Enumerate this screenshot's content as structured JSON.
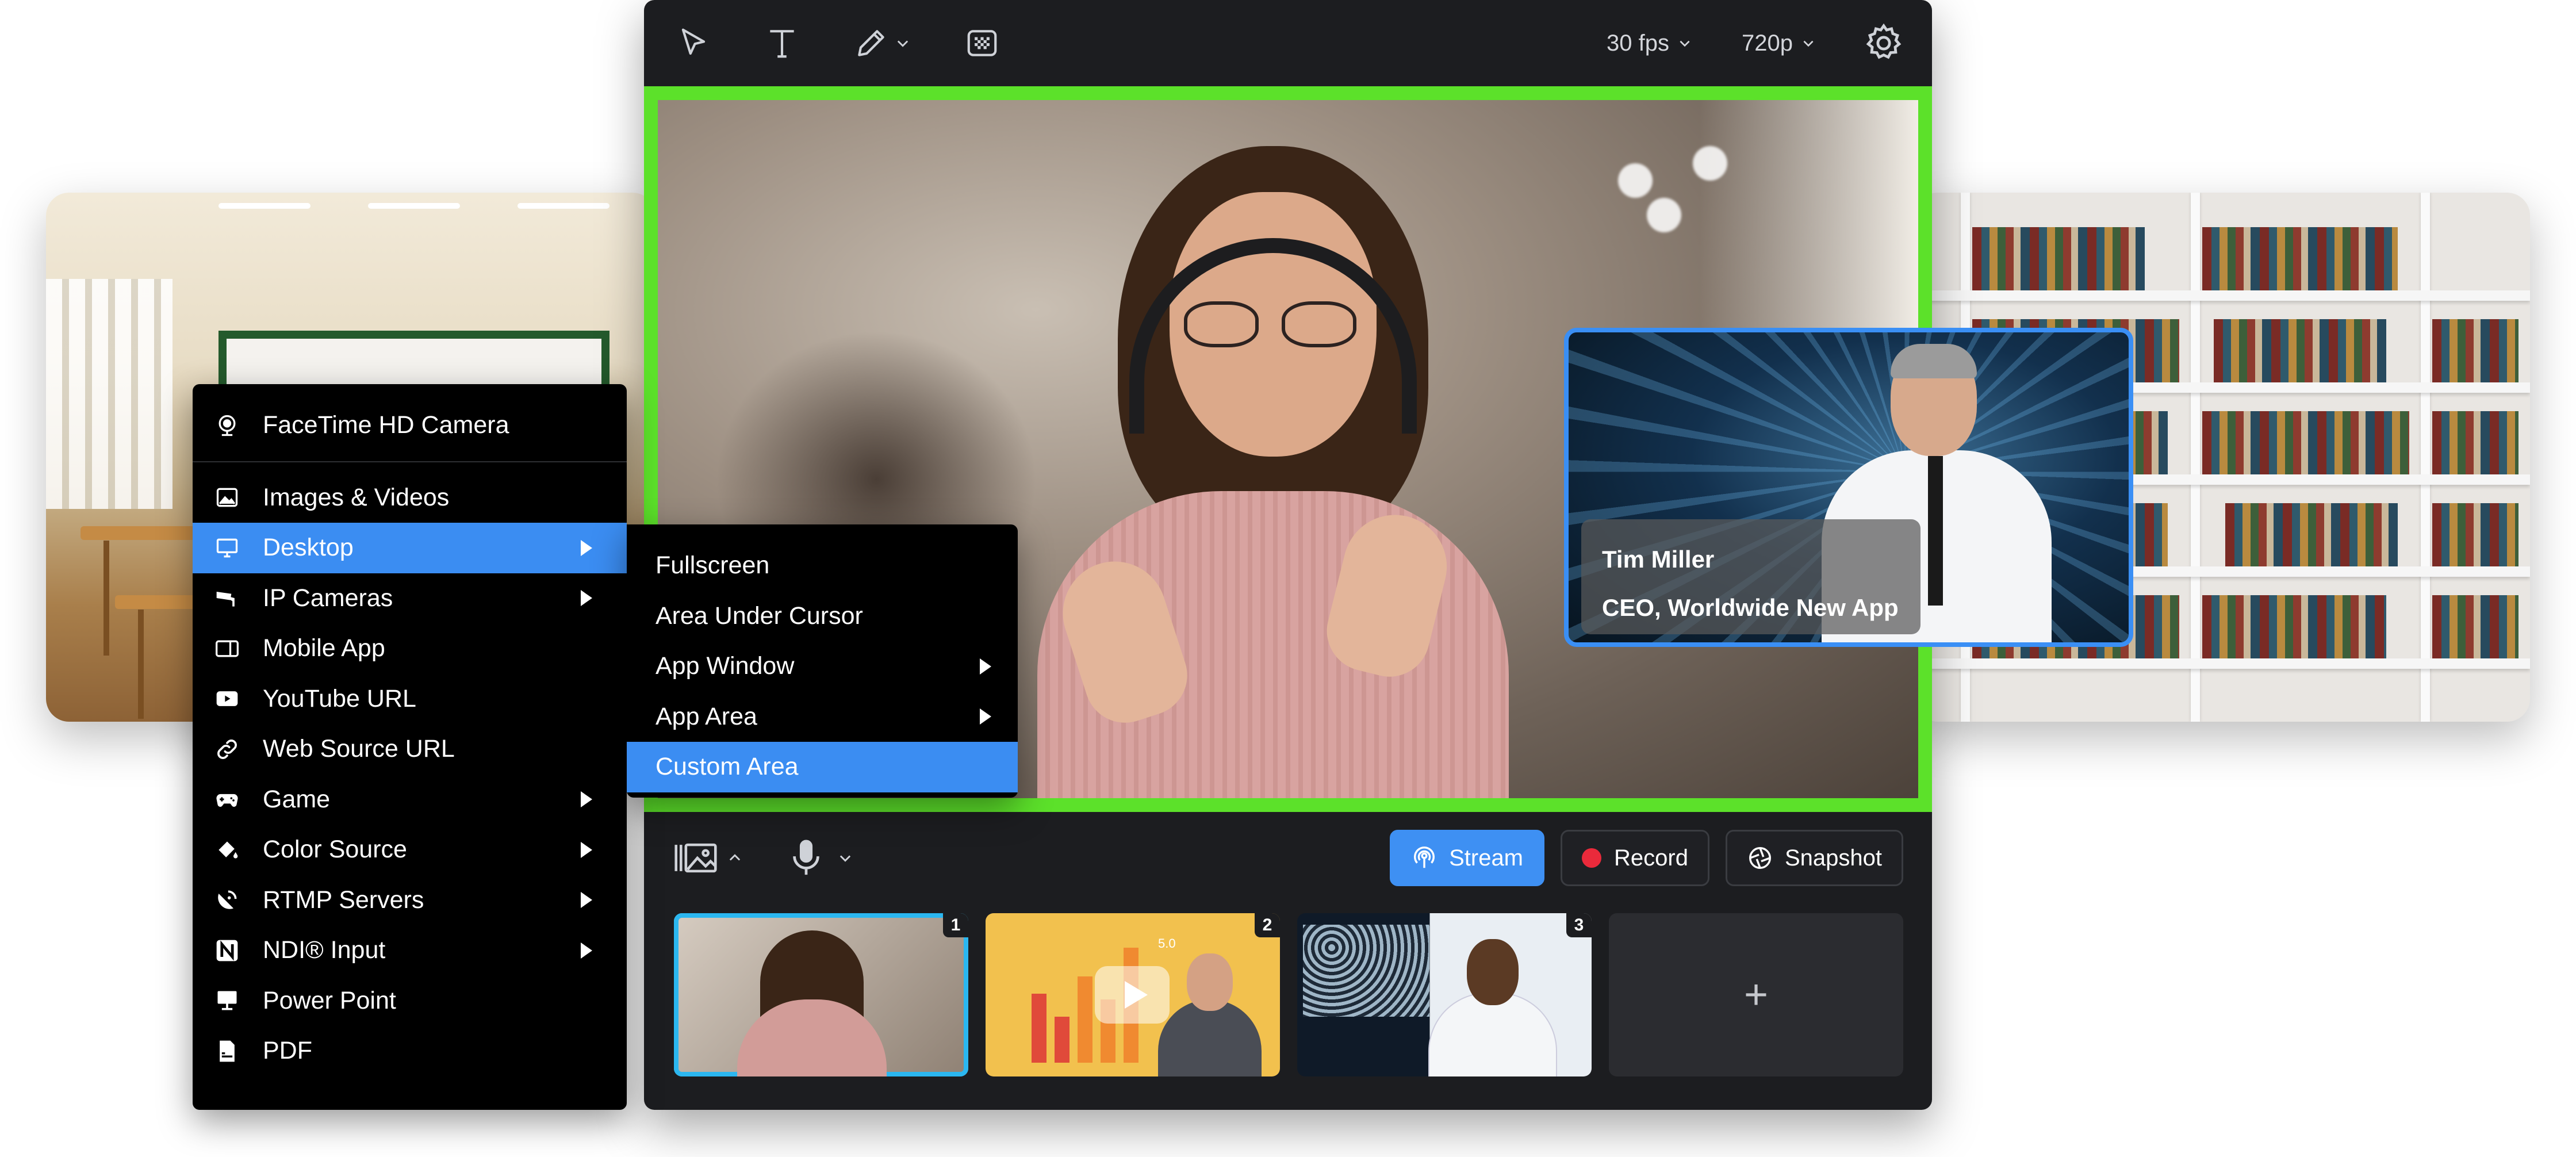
{
  "toolbar": {
    "fps_label": "30 fps",
    "resolution_label": "720p"
  },
  "overlay": {
    "name": "Tim Miller",
    "title": "CEO, Worldwide New App"
  },
  "controls": {
    "stream_label": "Stream",
    "record_label": "Record",
    "snapshot_label": "Snapshot"
  },
  "scenes": [
    {
      "number": "1"
    },
    {
      "number": "2"
    },
    {
      "number": "3"
    },
    {
      "add_label": "+"
    }
  ],
  "thumb2": {
    "chart_label": "5.0"
  },
  "source_menu": {
    "items": [
      {
        "label": "FaceTime HD Camera",
        "icon": "webcam-icon"
      },
      {
        "label": "Images & Videos",
        "icon": "image-icon"
      },
      {
        "label": "Desktop",
        "icon": "monitor-icon",
        "selected": true,
        "submenu": true
      },
      {
        "label": "IP Cameras",
        "icon": "cctv-icon",
        "submenu": true
      },
      {
        "label": "Mobile App",
        "icon": "mobile-icon"
      },
      {
        "label": "YouTube URL",
        "icon": "youtube-icon"
      },
      {
        "label": "Web Source URL",
        "icon": "link-icon"
      },
      {
        "label": "Game",
        "icon": "gamepad-icon",
        "submenu": true
      },
      {
        "label": "Color Source",
        "icon": "paint-bucket-icon",
        "submenu": true
      },
      {
        "label": "RTMP Servers",
        "icon": "satellite-dish-icon",
        "submenu": true
      },
      {
        "label": "NDI® Input",
        "icon": "ndi-icon",
        "submenu": true
      },
      {
        "label": "Power Point",
        "icon": "presentation-icon"
      },
      {
        "label": "PDF",
        "icon": "pdf-icon"
      }
    ]
  },
  "desktop_submenu": {
    "items": [
      {
        "label": "Fullscreen"
      },
      {
        "label": "Area Under Cursor"
      },
      {
        "label": "App Window",
        "submenu": true
      },
      {
        "label": "App Area",
        "submenu": true
      },
      {
        "label": "Custom Area",
        "selected": true
      }
    ]
  },
  "colors": {
    "accent": "#3b8df2",
    "preview_border": "#5ce12a",
    "record_dot": "#ea2a3b",
    "app_bg": "#1c1d20"
  }
}
